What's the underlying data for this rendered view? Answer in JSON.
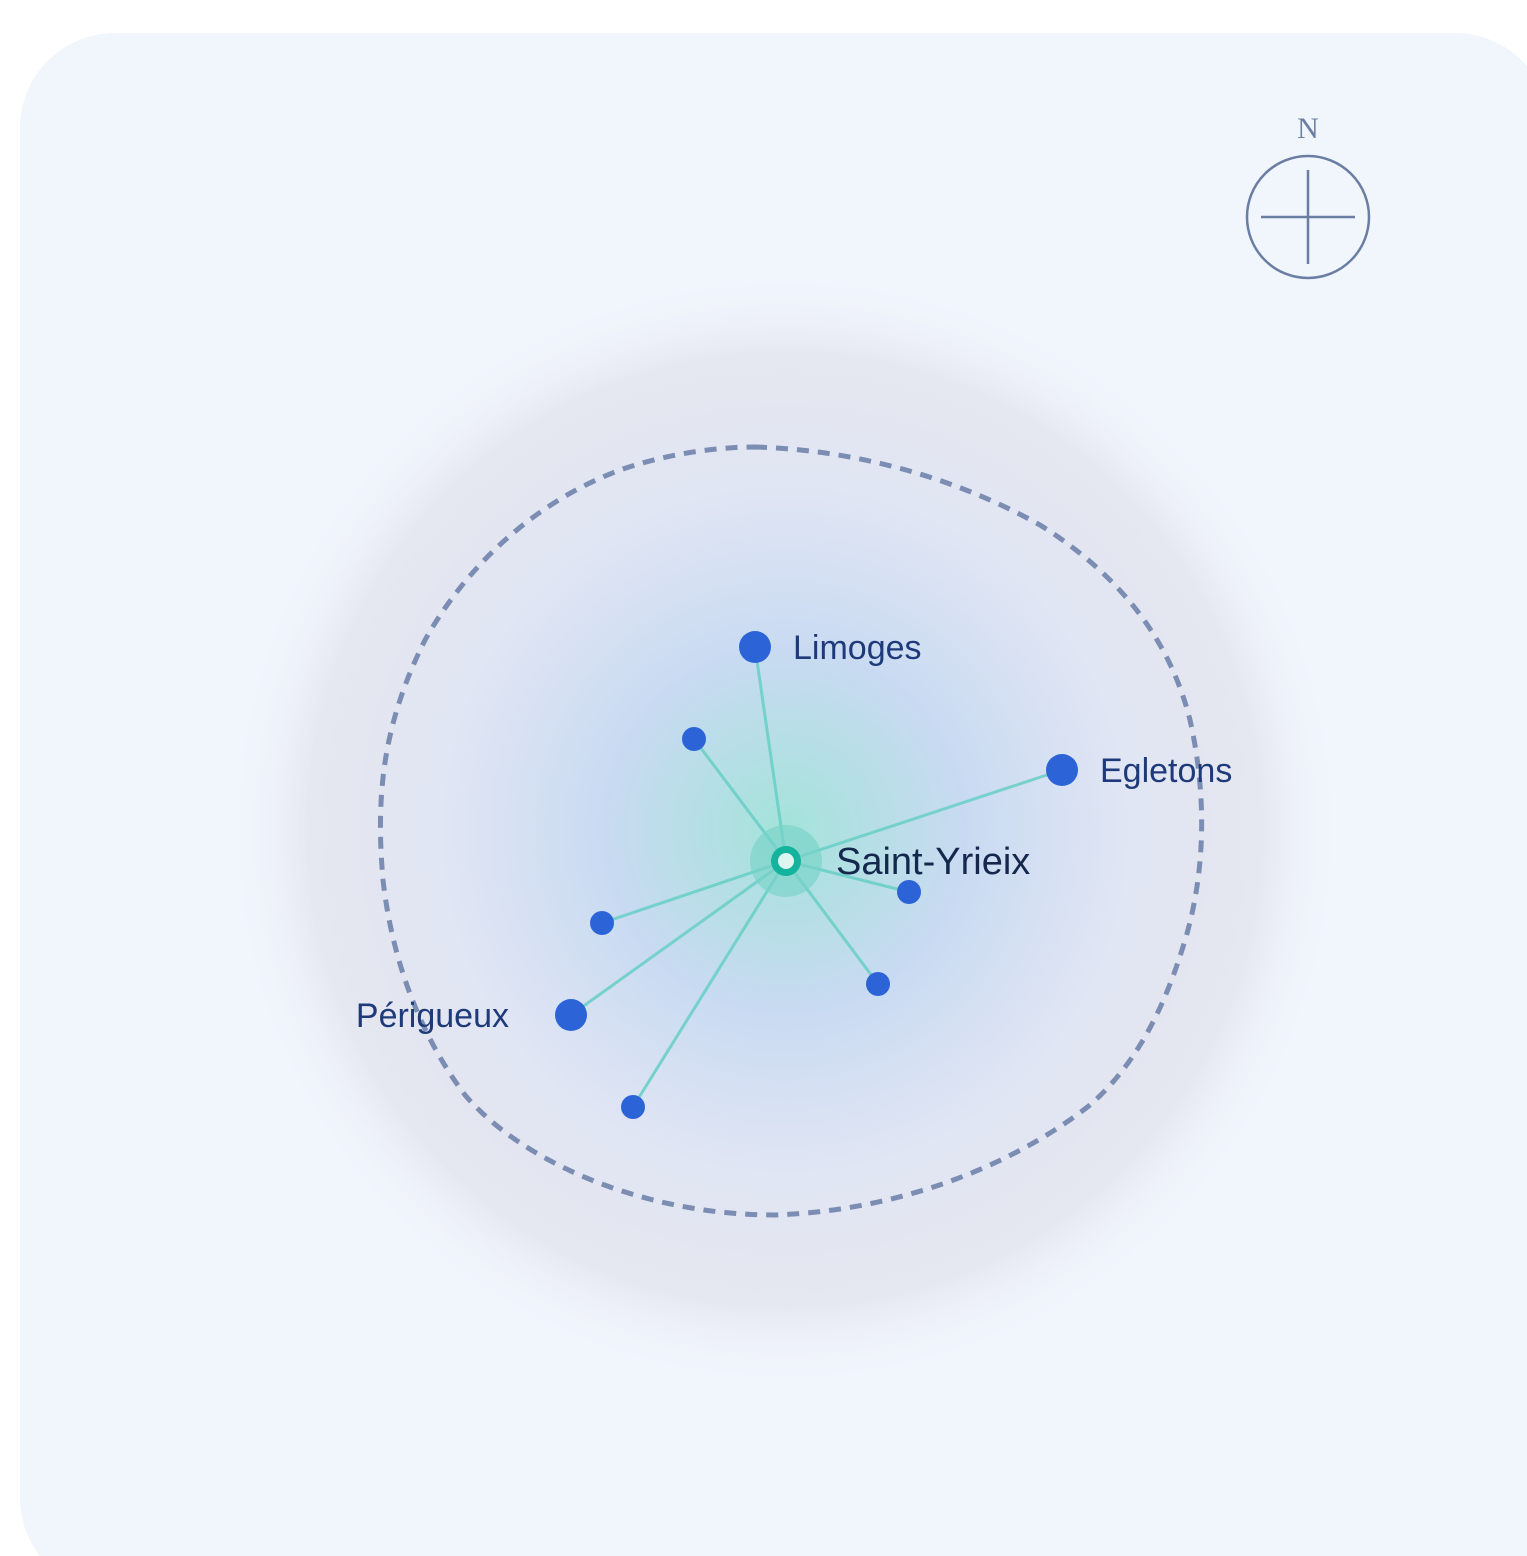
{
  "colors": {
    "card_bg": "#f1f5fc",
    "glow_blue": "#c6d9f1",
    "glow_teal": "#a3e3da",
    "halo_grey": "#dcdde7",
    "boundary": "#7b8db3",
    "spoke": "#6ccfc8",
    "node": "#2c64d8",
    "hub_outer": "#78d2c8",
    "hub_ring": "#13b39d",
    "hub_core": "#dff5f1",
    "label": "#1e3a7a",
    "hub_label": "#14284d",
    "compass": "#6a7ea3"
  },
  "compass": {
    "north_label": "N",
    "icon": "compass-rose-icon"
  },
  "hub": {
    "name": "Saint-Yrieix"
  },
  "destinations": [
    {
      "name": "Limoges",
      "labeled": true,
      "label_side": "right"
    },
    {
      "name": "Egletons",
      "labeled": true,
      "label_side": "right"
    },
    {
      "name": "Périgueux",
      "labeled": true,
      "label_side": "left"
    },
    {
      "name": "",
      "labeled": false
    },
    {
      "name": "",
      "labeled": false
    },
    {
      "name": "",
      "labeled": false
    },
    {
      "name": "",
      "labeled": false
    },
    {
      "name": "",
      "labeled": false
    }
  ],
  "service_area": {
    "style": "dashed"
  }
}
